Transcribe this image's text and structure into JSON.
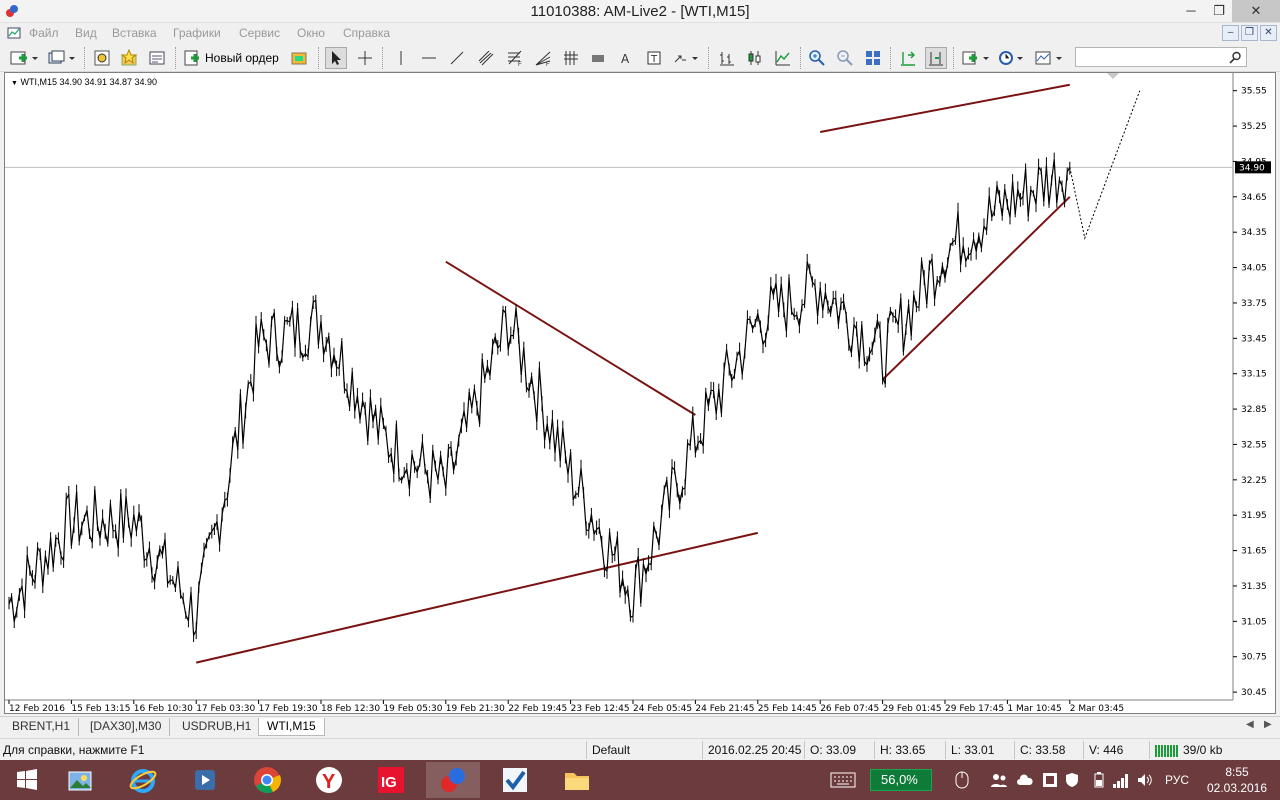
{
  "window": {
    "title": "11010388: AM-Live2 - [WTI,M15]",
    "controls": {
      "minimize": "─",
      "restore": "❐",
      "close": "✕"
    }
  },
  "menu": {
    "items": [
      "Файл",
      "Вид",
      "Вставка",
      "Графики",
      "Сервис",
      "Окно",
      "Справка"
    ],
    "mdi_controls": {
      "minimize": "–",
      "restore": "❐",
      "close": "✕"
    }
  },
  "toolbar": {
    "new_order_label": "Новый ордер"
  },
  "chart": {
    "info": "WTI,M15  34.90 34.91 34.87 34.90",
    "price_labels": [
      "35.55",
      "35.25",
      "34.95",
      "34.65",
      "34.35",
      "34.05",
      "33.75",
      "33.45",
      "33.15",
      "32.85",
      "32.55",
      "32.25",
      "31.95",
      "31.65",
      "31.35",
      "31.05",
      "30.75",
      "30.45"
    ],
    "current_price": "34.90",
    "time_labels": [
      "12 Feb 2016",
      "15 Feb 13:15",
      "16 Feb 10:30",
      "17 Feb 03:30",
      "17 Feb 19:30",
      "18 Feb 12:30",
      "19 Feb 05:30",
      "19 Feb 21:30",
      "22 Feb 19:45",
      "23 Feb 12:45",
      "24 Feb 05:45",
      "24 Feb 21:45",
      "25 Feb 14:45",
      "26 Feb 07:45",
      "29 Feb 01:45",
      "29 Feb 17:45",
      "1 Mar 10:45",
      "2 Mar 03:45"
    ],
    "colors": {
      "trendline": "#7a1212",
      "price": "#000000",
      "grid": "#bdbdbd"
    }
  },
  "chart_data": {
    "type": "line",
    "instrument": "WTI",
    "timeframe": "M15",
    "x": [
      "12 Feb 2016",
      "15 Feb 13:15",
      "16 Feb 10:30",
      "17 Feb 03:30",
      "17 Feb 19:30",
      "18 Feb 12:30",
      "19 Feb 05:30",
      "19 Feb 21:30",
      "22 Feb 19:45",
      "23 Feb 12:45",
      "24 Feb 05:45",
      "24 Feb 21:45",
      "25 Feb 14:45",
      "26 Feb 07:45",
      "29 Feb 01:45",
      "29 Feb 17:45",
      "1 Mar 10:45",
      "2 Mar 03:45"
    ],
    "series": [
      {
        "values": [
          31.2,
          31.9,
          31.9,
          31.1,
          33.4,
          33.6,
          32.6,
          32.2,
          33.6,
          32.3,
          31.3,
          32.6,
          33.6,
          33.9,
          33.3,
          34.2,
          34.6,
          34.9
        ]
      }
    ],
    "ohlc_last": {
      "open": 34.9,
      "high": 34.91,
      "low": 34.87,
      "close": 34.9
    },
    "current_price": 34.9,
    "ylim": [
      30.4,
      35.7
    ],
    "grid": false,
    "trendlines": [
      {
        "from": [
          "17 Feb 03:30",
          30.7
        ],
        "to": [
          "25 Feb 14:45",
          31.8
        ]
      },
      {
        "from": [
          "19 Feb 21:30",
          34.1
        ],
        "to": [
          "24 Feb 21:45",
          32.8
        ]
      },
      {
        "from": [
          "26 Feb 07:45",
          35.2
        ],
        "to": [
          "2 Mar 03:45",
          35.6
        ]
      },
      {
        "from": [
          "29 Feb 01:45",
          33.1
        ],
        "to": [
          "2 Mar 03:45",
          34.65
        ]
      }
    ]
  },
  "tabs": [
    {
      "label": "BRENT,H1",
      "active": false
    },
    {
      "label": "[DAX30],M30",
      "active": false
    },
    {
      "label": "USDRUB,H1",
      "active": false
    },
    {
      "label": "WTI,M15",
      "active": true
    }
  ],
  "statusbar": {
    "help": "Для справки, нажмите F1",
    "profile": "Default",
    "datetime": "2016.02.25 20:45",
    "open": "O: 33.09",
    "high": "H: 33.65",
    "low": "L: 33.01",
    "close": "C: 33.58",
    "volume": "V: 446",
    "traffic": "39/0 kb"
  },
  "taskbar": {
    "battery": "56,0%",
    "language": "РУС",
    "time": "8:55",
    "date": "02.03.2016"
  }
}
